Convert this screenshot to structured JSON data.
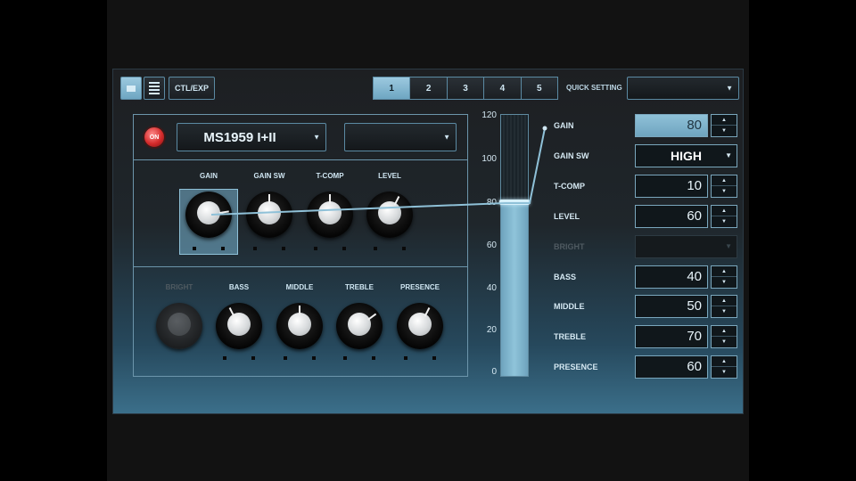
{
  "toolbar": {
    "view_icon_1": "panel-view-icon",
    "view_icon_2": "list-view-icon",
    "ctl_exp_label": "CTL/EXP",
    "patches": [
      "1",
      "2",
      "3",
      "4",
      "5"
    ],
    "active_patch": "1",
    "quick_setting_label": "QUICK SETTING",
    "quick_setting_value": ""
  },
  "effect": {
    "on_label": "ON",
    "model": "MS1959 I+II",
    "sub_select": "",
    "knobs_row1": [
      {
        "label": "GAIN",
        "value": 80
      },
      {
        "label": "GAIN SW",
        "value": 50
      },
      {
        "label": "T-COMP",
        "value": 50
      },
      {
        "label": "LEVEL",
        "value": 60
      }
    ],
    "knobs_row2": [
      {
        "label": "BRIGHT",
        "value": 0,
        "disabled": true
      },
      {
        "label": "BASS",
        "value": 40
      },
      {
        "label": "MIDDLE",
        "value": 50
      },
      {
        "label": "TREBLE",
        "value": 70
      },
      {
        "label": "PRESENCE",
        "value": 60
      }
    ]
  },
  "slider": {
    "scale": [
      "120",
      "100",
      "80",
      "60",
      "40",
      "20",
      "0"
    ],
    "max": 120,
    "value": 80
  },
  "params": [
    {
      "label": "GAIN",
      "value": "80",
      "type": "number",
      "active": true
    },
    {
      "label": "GAIN SW",
      "value": "HIGH",
      "type": "select"
    },
    {
      "label": "T-COMP",
      "value": "10",
      "type": "number"
    },
    {
      "label": "LEVEL",
      "value": "60",
      "type": "number"
    },
    {
      "label": "BRIGHT",
      "value": "",
      "type": "select",
      "disabled": true
    },
    {
      "label": "BASS",
      "value": "40",
      "type": "number"
    },
    {
      "label": "MIDDLE",
      "value": "50",
      "type": "number"
    },
    {
      "label": "TREBLE",
      "value": "70",
      "type": "number"
    },
    {
      "label": "PRESENCE",
      "value": "60",
      "type": "number"
    }
  ],
  "colors": {
    "accent": "#8fc1d8",
    "on_button": "#d42b2b",
    "panel_border": "#6c95ab"
  }
}
